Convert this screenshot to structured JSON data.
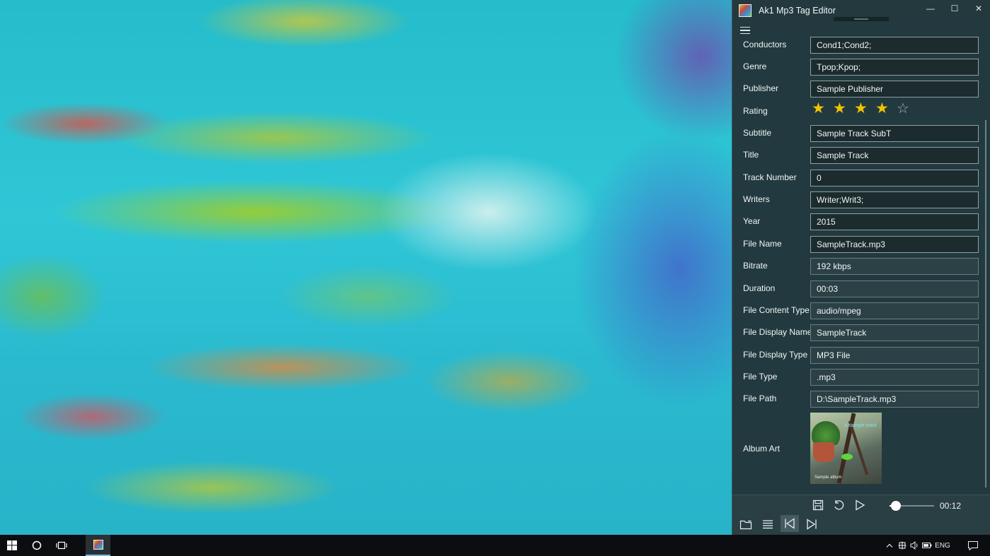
{
  "window": {
    "title": "Ak1 Mp3 Tag Editor",
    "minimize_glyph": "—",
    "maximize_glyph": "☐",
    "close_glyph": "✕"
  },
  "form": {
    "conductors": {
      "label": "Conductors",
      "value": "Cond1;Cond2;"
    },
    "genre": {
      "label": "Genre",
      "value": "Tpop;Kpop;"
    },
    "publisher": {
      "label": "Publisher",
      "value": "Sample Publisher"
    },
    "rating": {
      "label": "Rating",
      "stars": 4,
      "max": 5
    },
    "subtitle": {
      "label": "Subtitle",
      "value": "Sample Track SubT"
    },
    "title": {
      "label": "Title",
      "value": "Sample Track"
    },
    "track_number": {
      "label": "Track Number",
      "value": "0"
    },
    "writers": {
      "label": "Writers",
      "value": "Writer;Writ3;"
    },
    "year": {
      "label": "Year",
      "value": "2015"
    },
    "file_name": {
      "label": "File Name",
      "value": "SampleTrack.mp3"
    },
    "bitrate": {
      "label": "Bitrate",
      "value": "192 kbps"
    },
    "duration": {
      "label": "Duration",
      "value": "00:03"
    },
    "file_content_type": {
      "label": "File Content Type",
      "value": "audio/mpeg"
    },
    "file_display_name": {
      "label": "File Display Name",
      "value": "SampleTrack"
    },
    "file_display_type": {
      "label": "File Display Type",
      "value": "MP3 File"
    },
    "file_type": {
      "label": "File Type",
      "value": ".mp3"
    },
    "file_path": {
      "label": "File Path",
      "value": "D:\\SampleTrack.mp3"
    },
    "album_art": {
      "label": "Album Art",
      "caption_top": "A sample track",
      "caption_bottom": "Sample album"
    }
  },
  "player": {
    "time": "00:12",
    "progress": 0.15
  },
  "icons": {
    "save": "save-icon",
    "undo": "undo-icon",
    "play": "play-icon",
    "open_folder": "folder-icon",
    "playlist": "list-icon",
    "previous": "previous-track-icon",
    "next": "next-track-icon"
  },
  "taskbar": {
    "language": "ENG"
  },
  "colors": {
    "star": "#f2c400",
    "panel_bg": "#223a3f"
  }
}
